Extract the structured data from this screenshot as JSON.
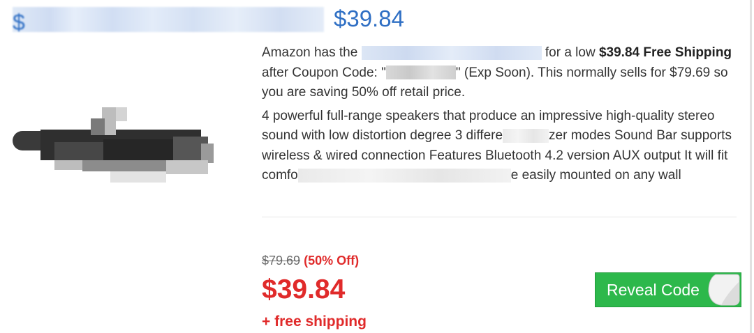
{
  "deal": {
    "title_price": "$39.84",
    "title_dollar_fragment": "$"
  },
  "description": {
    "p1_a": "Amazon has the ",
    "p1_b": " for a low ",
    "p1_bold": "$39.84 Free Shipping",
    "p1_c": " after Coupon Code: \"",
    "p1_d": "\" (Exp Soon). This normally sells for $79.69 so you are saving 50% off retail price.",
    "p2_a": "4 powerful full-range speakers that produce an impressive high-quality stereo sound with low distortion degree 3 differe",
    "p2_b": "zer modes Sound Bar supports wireless & wired connection Features Bluetooth 4.2 version AUX output It will fit comfo",
    "p2_c": "e easily mounted on any wall"
  },
  "pricing": {
    "original": "$79.69",
    "discount": "(50% Off)",
    "current": "$39.84",
    "shipping": "+ free shipping"
  },
  "action": {
    "reveal_label": "Reveal Code"
  },
  "colors": {
    "link_blue": "#2f6fc4",
    "price_red": "#e02a2a",
    "button_green": "#2db84b"
  }
}
